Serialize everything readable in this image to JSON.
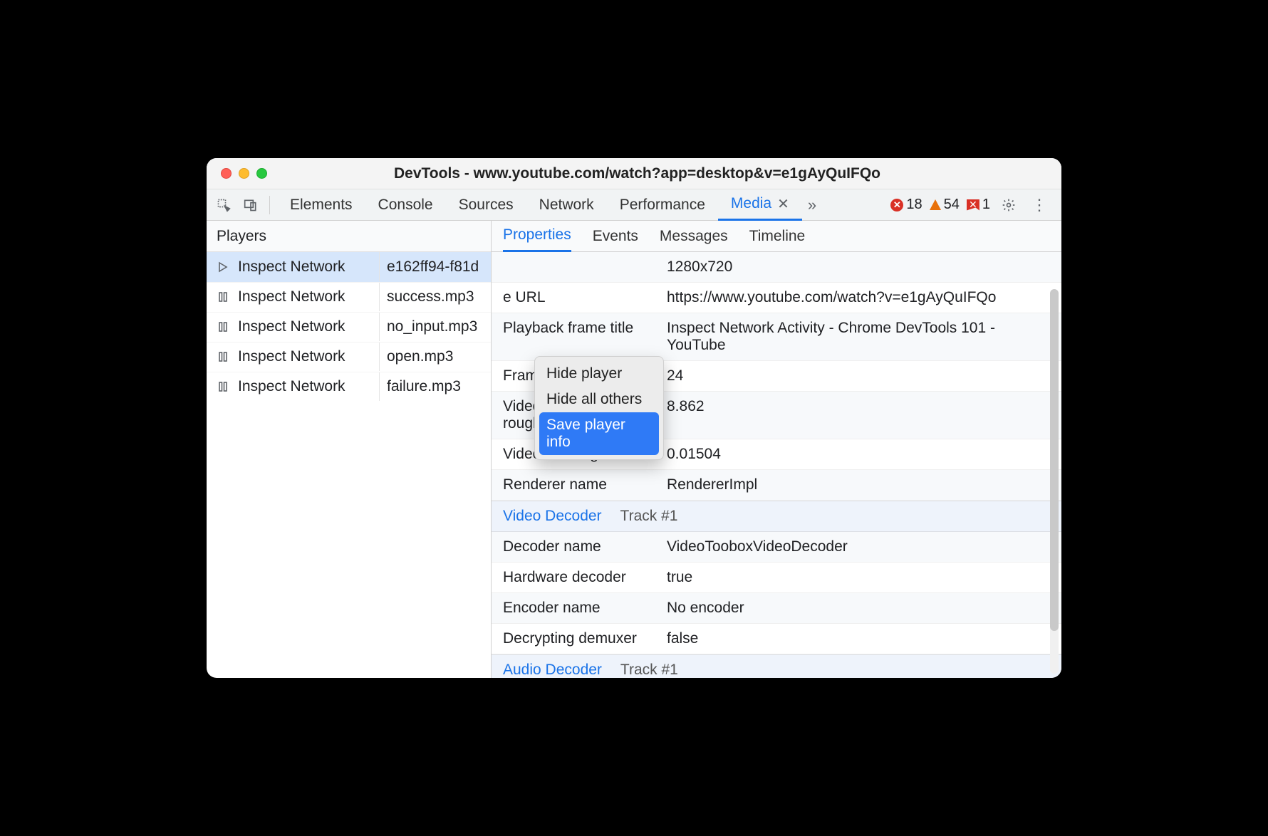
{
  "window": {
    "title": "DevTools - www.youtube.com/watch?app=desktop&v=e1gAyQuIFQo"
  },
  "toolbar": {
    "tabs": [
      {
        "label": "Elements"
      },
      {
        "label": "Console"
      },
      {
        "label": "Sources"
      },
      {
        "label": "Network"
      },
      {
        "label": "Performance"
      },
      {
        "label": "Media",
        "active": true
      }
    ],
    "errors_count": "18",
    "warnings_count": "54",
    "issues_count": "1"
  },
  "sidebar": {
    "heading": "Players",
    "items": [
      {
        "label": "Inspect Network",
        "file": "e162ff94-f81d",
        "type": "play",
        "selected": true
      },
      {
        "label": "Inspect Network",
        "file": "success.mp3",
        "type": "pause"
      },
      {
        "label": "Inspect Network",
        "file": "no_input.mp3",
        "type": "pause"
      },
      {
        "label": "Inspect Network",
        "file": "open.mp3",
        "type": "pause"
      },
      {
        "label": "Inspect Network",
        "file": "failure.mp3",
        "type": "pause"
      }
    ]
  },
  "subtabs": [
    {
      "label": "Properties",
      "active": true
    },
    {
      "label": "Events"
    },
    {
      "label": "Messages"
    },
    {
      "label": "Timeline"
    }
  ],
  "context_menu": {
    "items": [
      {
        "label": "Hide player"
      },
      {
        "label": "Hide all others"
      },
      {
        "label": "Save player info",
        "highlighted": true
      }
    ]
  },
  "properties": {
    "rows_top": [
      {
        "key": "",
        "value": "1280x720"
      },
      {
        "key": "e URL",
        "value": "https://www.youtube.com/watch?v=e1gAyQuIFQo"
      },
      {
        "key": "Playback frame title",
        "value": "Inspect Network Activity - Chrome DevTools 101 - YouTube"
      },
      {
        "key": "Frame rate",
        "value": "24"
      },
      {
        "key": "Video playback roughness",
        "value": "8.862"
      },
      {
        "key": "Video freezing score",
        "value": "0.01504"
      },
      {
        "key": "Renderer name",
        "value": "RendererImpl"
      }
    ],
    "section_video": {
      "title": "Video Decoder",
      "sub": "Track #1"
    },
    "rows_video": [
      {
        "key": "Decoder name",
        "value": "VideoTooboxVideoDecoder"
      },
      {
        "key": "Hardware decoder",
        "value": "true"
      },
      {
        "key": "Encoder name",
        "value": "No encoder"
      },
      {
        "key": "Decrypting demuxer",
        "value": "false"
      }
    ],
    "section_audio": {
      "title": "Audio Decoder",
      "sub": "Track #1"
    }
  }
}
